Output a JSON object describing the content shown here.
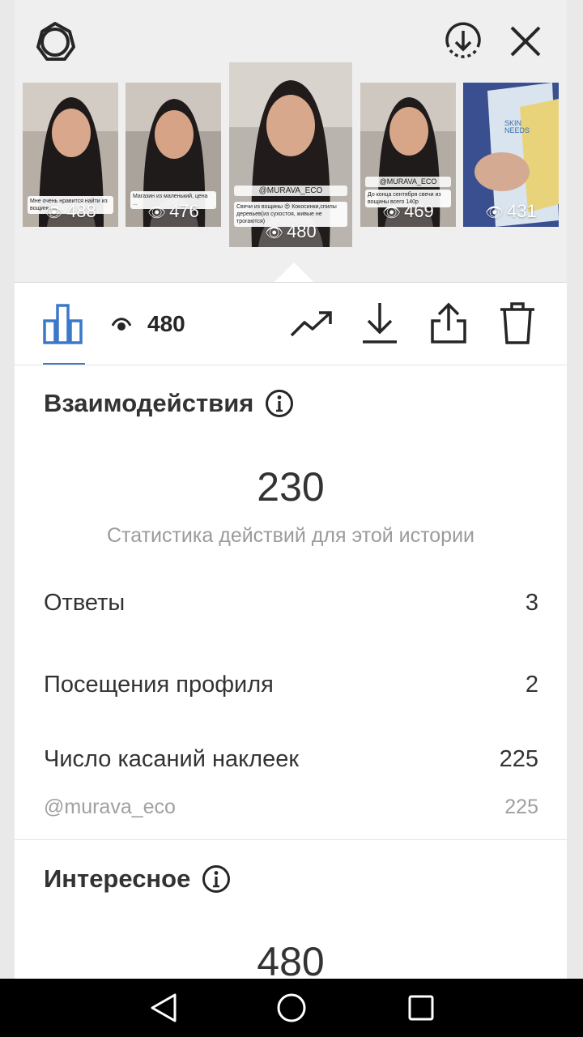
{
  "top_bar": {
    "left_icon": "settings-gear-icon",
    "right_icons": [
      "download-circle-icon",
      "close-icon"
    ]
  },
  "stories": [
    {
      "views": "488",
      "caption": "Мне очень нравится найти из вощины ...",
      "selected": false
    },
    {
      "views": "476",
      "caption": "Магазин из маленький, цена ... ",
      "selected": false
    },
    {
      "views": "480",
      "caption": "Свечи из вощины 😍 Кокосинки,спилы деревьев(из сухостоя, живые не трогаются)",
      "tag": "@MURAVA_ECO",
      "selected": true
    },
    {
      "views": "469",
      "caption": "До конца сентября свечи из вощины всего 140р",
      "tag": "@MURAVA_ECO",
      "selected": false
    },
    {
      "views": "431",
      "caption": "SKIN NEEDS",
      "selected": false
    }
  ],
  "toolbar": {
    "views": "480",
    "icons": [
      "bar-chart-icon",
      "eye-icon",
      "trend-icon",
      "download-icon",
      "share-icon",
      "trash-icon"
    ]
  },
  "interactions": {
    "title": "Взаимодействия",
    "total": "230",
    "subtitle": "Статистика действий для этой истории",
    "rows": [
      {
        "label": "Ответы",
        "value": "3"
      },
      {
        "label": "Посещения профиля",
        "value": "2"
      },
      {
        "label": "Число касаний наклеек",
        "value": "225"
      }
    ],
    "sticker_row": {
      "label": "@murava_eco",
      "value": "225"
    }
  },
  "discovery": {
    "title": "Интересное",
    "total": "480"
  },
  "colors": {
    "accent": "#3c78c9",
    "text": "#262626",
    "muted": "#9b9b9b"
  }
}
